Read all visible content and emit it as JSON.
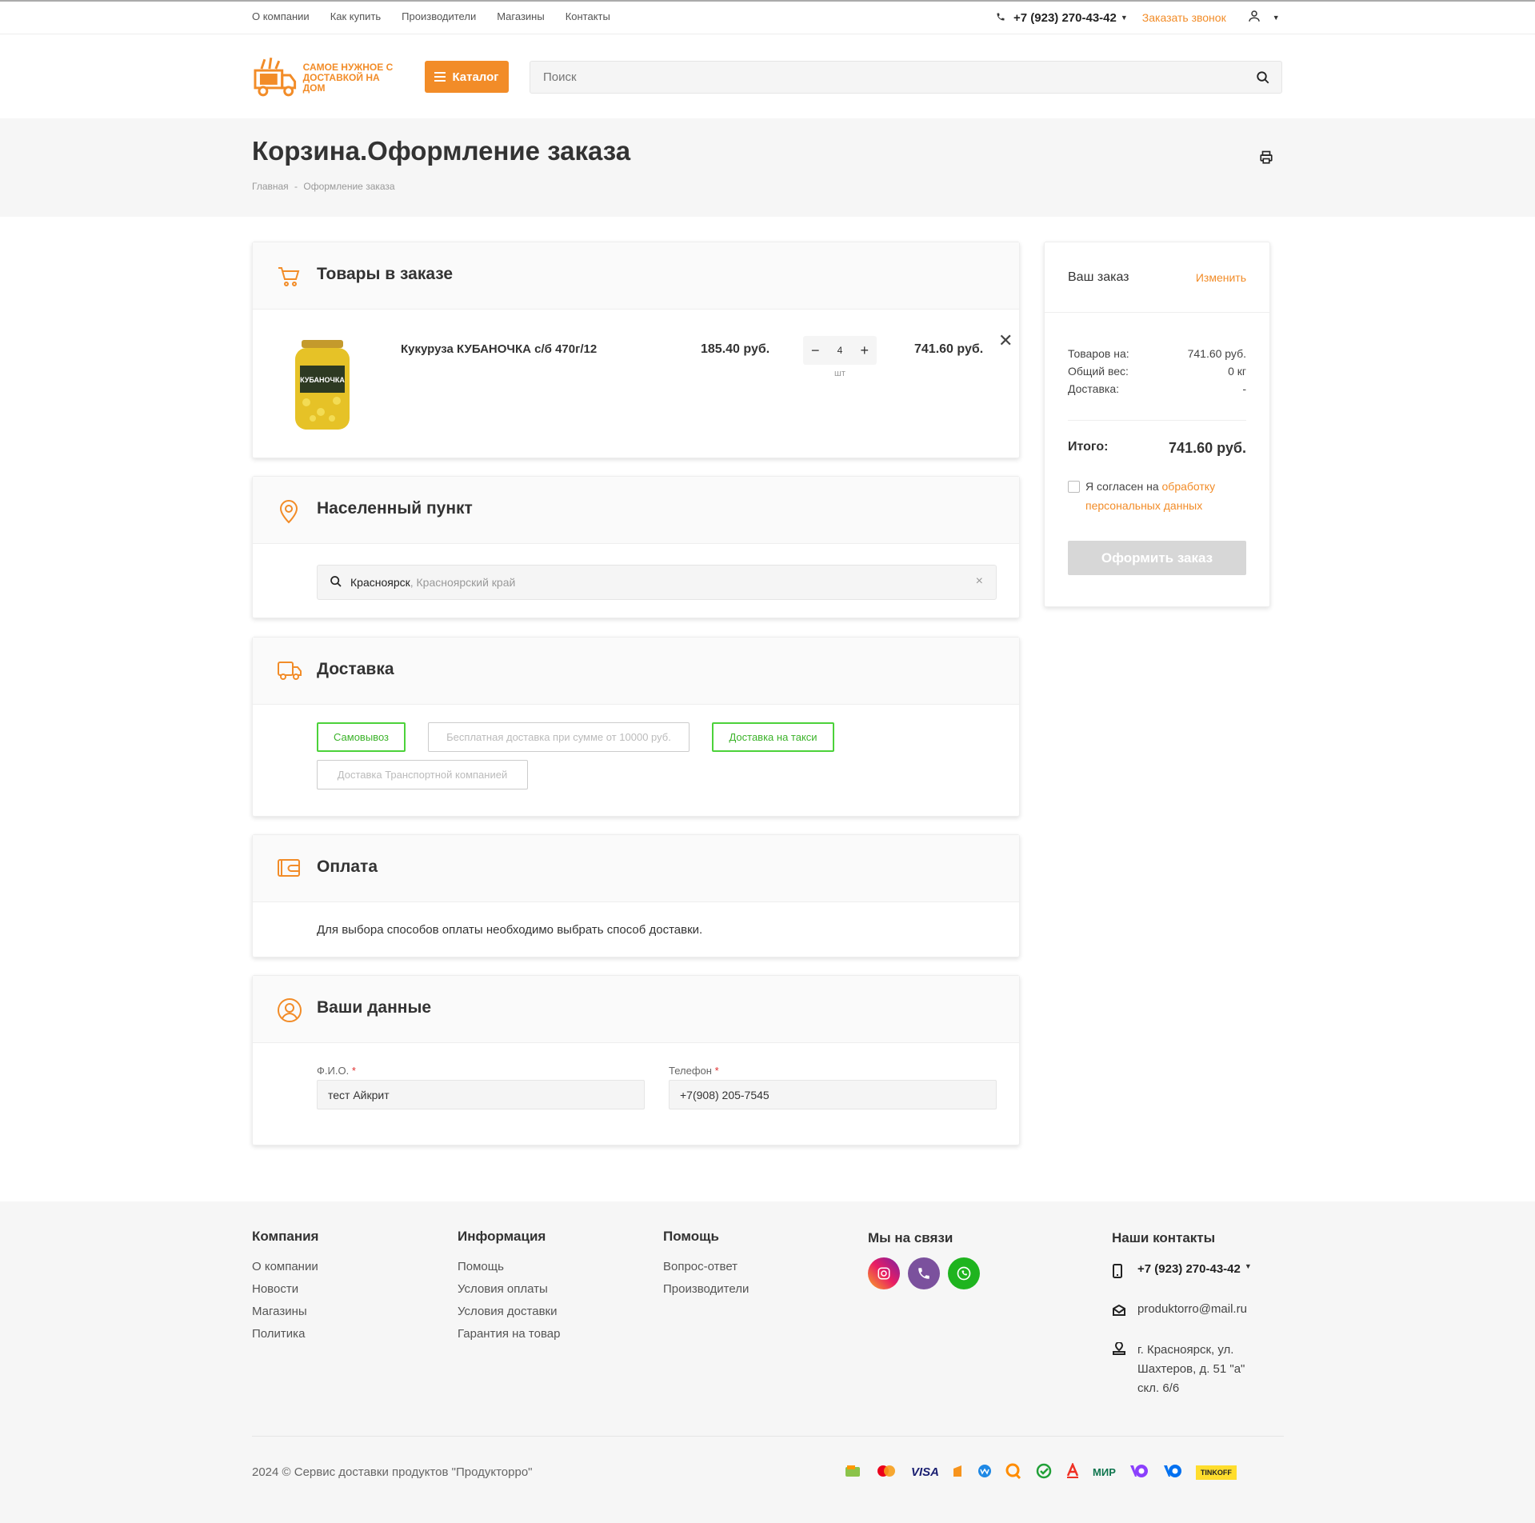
{
  "topnav": [
    "О компании",
    "Как купить",
    "Производители",
    "Магазины",
    "Контакты"
  ],
  "header": {
    "phone": "+7 (923) 270-43-42",
    "callback": "Заказать звонок",
    "logo_text_1": "САМОЕ НУЖНОЕ С",
    "logo_text_2": "ДОСТАВКОЙ НА ДОМ",
    "catalog": "Каталог",
    "search_placeholder": "Поиск"
  },
  "page": {
    "title": "Корзина.Оформление заказа",
    "breadcrumb_home": "Главная",
    "breadcrumb_sep": "-",
    "breadcrumb_current": "Оформление заказа"
  },
  "items_section": {
    "title": "Товары в заказе",
    "items": [
      {
        "name": "Кукуруза КУБАНОЧКА с/б 470г/12",
        "price": "185.40 руб.",
        "qty": "4",
        "unit": "шт",
        "sum": "741.60 руб.",
        "jar_label": "КУБАНОЧКА"
      }
    ]
  },
  "city_section": {
    "title": "Населенный пункт",
    "city": "Красноярск",
    "region": ", Красноярский край"
  },
  "delivery_section": {
    "title": "Доставка",
    "options": [
      {
        "label": "Самовывоз",
        "state": "active"
      },
      {
        "label": "Бесплатная доставка при сумме от 10000 руб.",
        "state": "disabled"
      },
      {
        "label": "Доставка на такси",
        "state": "active"
      },
      {
        "label": "Доставка Транспортной компанией",
        "state": "disabled"
      }
    ]
  },
  "payment_section": {
    "title": "Оплата",
    "note": "Для выбора способов оплаты необходимо выбрать способ доставки."
  },
  "user_section": {
    "title": "Ваши данные",
    "name_label": "Ф.И.О.",
    "name_value": "тест Айкрит",
    "phone_label": "Телефон",
    "phone_value": "+7(908) 205-7545",
    "required_mark": "*"
  },
  "summary": {
    "title": "Ваш заказ",
    "change": "Изменить",
    "goods_label": "Товаров на:",
    "goods_value": "741.60 руб.",
    "weight_label": "Общий вес:",
    "weight_value": "0 кг",
    "delivery_label": "Доставка:",
    "delivery_value": "-",
    "total_label": "Итого:",
    "total_value": "741.60 руб.",
    "agree_prefix": "Я согласен на ",
    "agree_link": "обработку персональных данных",
    "order_button": "Оформить заказ"
  },
  "footer": {
    "company_title": "Компания",
    "company_links": [
      "О компании",
      "Новости",
      "Магазины",
      "Политика"
    ],
    "info_title": "Информация",
    "info_links": [
      "Помощь",
      "Условия оплаты",
      "Условия доставки",
      "Гарантия на товар"
    ],
    "help_title": "Помощь",
    "help_links": [
      "Вопрос-ответ",
      "Производители"
    ],
    "social_title": "Мы на связи",
    "contacts_title": "Наши контакты",
    "phone": "+7 (923) 270-43-42",
    "email": "produktorro@mail.ru",
    "address_1": "г. Красноярск, ул.",
    "address_2": "Шахтеров, д. 51 \"а\"",
    "address_3": "скл. 6/6",
    "copyright": "2024 © Сервис доставки продуктов \"Продукторро\"",
    "pay_visa": "VISA",
    "pay_mir": "МИР",
    "pay_tinkoff": "TINKOFF"
  },
  "colors": {
    "accent": "#f28c28",
    "green": "#4cd23a",
    "disabled_button": "#d7d7d7"
  }
}
